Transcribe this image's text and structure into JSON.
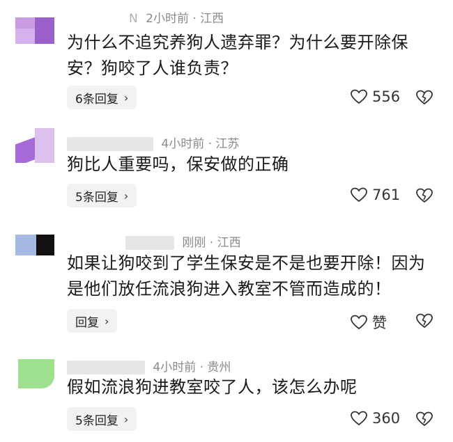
{
  "comments": [
    {
      "username_visible": "N",
      "time_location": "2小时前 · 江西",
      "text": "为什么不追究养狗人遗弃罪？为什么要开除保安？狗咬了人谁负责？",
      "reply_label": "6条回复",
      "likes": "556",
      "avatar_colors": [
        "#c79ae0",
        "#9b5fc9"
      ]
    },
    {
      "username_visible": "",
      "time_location": "4小时前 · 江苏",
      "text": "狗比人重要吗，保安做的正确",
      "reply_label": "5条回复",
      "likes": "761",
      "avatar_colors": [
        "#d8b4ee",
        "#a56ad8"
      ]
    },
    {
      "username_visible": "",
      "time_location": "刚刚 · 江西",
      "text": "如果让狗咬到了学生保安是不是也要开除！因为是他们放任流浪狗进入教室不管而造成的！",
      "reply_label": "回复",
      "likes": "赞",
      "avatar_colors": [
        "#9fb4e0",
        "#111111"
      ]
    },
    {
      "username_visible": "",
      "time_location": "4小时前 · 贵州",
      "text": "假如流浪狗进教室咬了人，该怎么办呢",
      "reply_label": "5条回复",
      "likes": "360",
      "avatar_colors": [
        "#9ee08e",
        "#e8e8e8"
      ]
    }
  ],
  "chevron": "›",
  "icons": {
    "like": "heart-outline-icon",
    "dislike": "broken-heart-outline-icon"
  }
}
